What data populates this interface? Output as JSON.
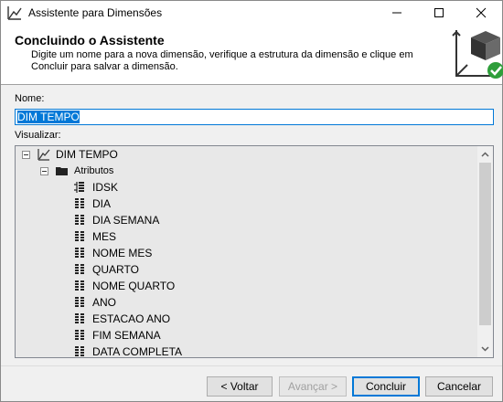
{
  "window": {
    "title": "Assistente para Dimensões"
  },
  "header": {
    "title": "Concluindo o Assistente",
    "description": "Digite um nome para a nova dimensão, verifique a estrutura da dimensão e clique em Concluir para salvar a dimensão."
  },
  "form": {
    "name_label": "Nome:",
    "name_value": "DIM TEMPO",
    "preview_label": "Visualizar:"
  },
  "tree": {
    "root": "DIM TEMPO",
    "folder": "Atributos",
    "key_attribute": "IDSK",
    "attributes": [
      "DIA",
      "DIA SEMANA",
      "MES",
      "NOME MES",
      "QUARTO",
      "NOME QUARTO",
      "ANO",
      "ESTACAO ANO",
      "FIM SEMANA",
      "DATA COMPLETA"
    ]
  },
  "buttons": {
    "back": "< Voltar",
    "next": "Avançar >",
    "finish": "Concluir",
    "cancel": "Cancelar"
  },
  "colors": {
    "accent": "#0078d7",
    "success": "#2e9e3a"
  }
}
